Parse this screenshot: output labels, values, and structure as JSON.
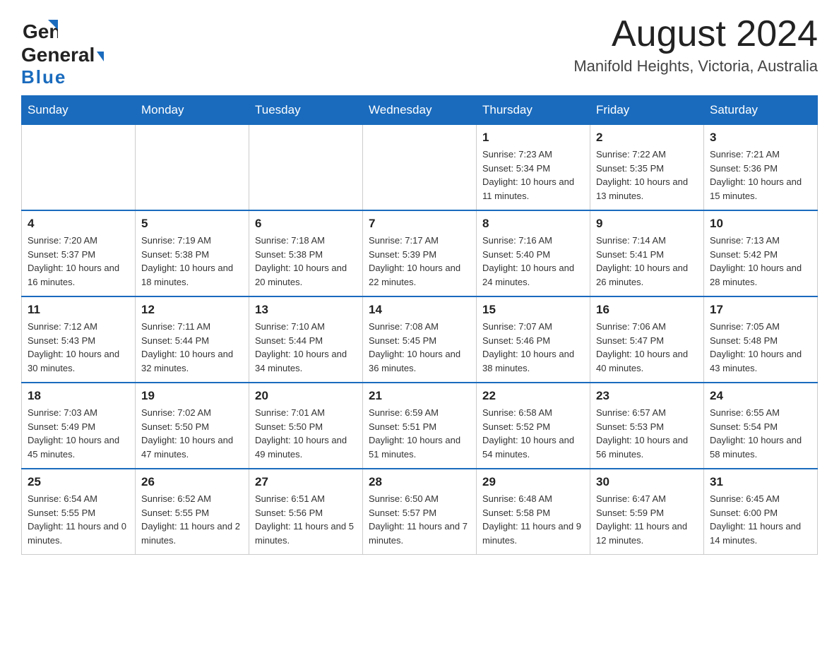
{
  "header": {
    "logo_line1": "General",
    "logo_line2": "Blue",
    "title": "August 2024",
    "subtitle": "Manifold Heights, Victoria, Australia"
  },
  "weekdays": [
    "Sunday",
    "Monday",
    "Tuesday",
    "Wednesday",
    "Thursday",
    "Friday",
    "Saturday"
  ],
  "weeks": [
    [
      {
        "day": "",
        "sunrise": "",
        "sunset": "",
        "daylight": ""
      },
      {
        "day": "",
        "sunrise": "",
        "sunset": "",
        "daylight": ""
      },
      {
        "day": "",
        "sunrise": "",
        "sunset": "",
        "daylight": ""
      },
      {
        "day": "",
        "sunrise": "",
        "sunset": "",
        "daylight": ""
      },
      {
        "day": "1",
        "sunrise": "Sunrise: 7:23 AM",
        "sunset": "Sunset: 5:34 PM",
        "daylight": "Daylight: 10 hours and 11 minutes."
      },
      {
        "day": "2",
        "sunrise": "Sunrise: 7:22 AM",
        "sunset": "Sunset: 5:35 PM",
        "daylight": "Daylight: 10 hours and 13 minutes."
      },
      {
        "day": "3",
        "sunrise": "Sunrise: 7:21 AM",
        "sunset": "Sunset: 5:36 PM",
        "daylight": "Daylight: 10 hours and 15 minutes."
      }
    ],
    [
      {
        "day": "4",
        "sunrise": "Sunrise: 7:20 AM",
        "sunset": "Sunset: 5:37 PM",
        "daylight": "Daylight: 10 hours and 16 minutes."
      },
      {
        "day": "5",
        "sunrise": "Sunrise: 7:19 AM",
        "sunset": "Sunset: 5:38 PM",
        "daylight": "Daylight: 10 hours and 18 minutes."
      },
      {
        "day": "6",
        "sunrise": "Sunrise: 7:18 AM",
        "sunset": "Sunset: 5:38 PM",
        "daylight": "Daylight: 10 hours and 20 minutes."
      },
      {
        "day": "7",
        "sunrise": "Sunrise: 7:17 AM",
        "sunset": "Sunset: 5:39 PM",
        "daylight": "Daylight: 10 hours and 22 minutes."
      },
      {
        "day": "8",
        "sunrise": "Sunrise: 7:16 AM",
        "sunset": "Sunset: 5:40 PM",
        "daylight": "Daylight: 10 hours and 24 minutes."
      },
      {
        "day": "9",
        "sunrise": "Sunrise: 7:14 AM",
        "sunset": "Sunset: 5:41 PM",
        "daylight": "Daylight: 10 hours and 26 minutes."
      },
      {
        "day": "10",
        "sunrise": "Sunrise: 7:13 AM",
        "sunset": "Sunset: 5:42 PM",
        "daylight": "Daylight: 10 hours and 28 minutes."
      }
    ],
    [
      {
        "day": "11",
        "sunrise": "Sunrise: 7:12 AM",
        "sunset": "Sunset: 5:43 PM",
        "daylight": "Daylight: 10 hours and 30 minutes."
      },
      {
        "day": "12",
        "sunrise": "Sunrise: 7:11 AM",
        "sunset": "Sunset: 5:44 PM",
        "daylight": "Daylight: 10 hours and 32 minutes."
      },
      {
        "day": "13",
        "sunrise": "Sunrise: 7:10 AM",
        "sunset": "Sunset: 5:44 PM",
        "daylight": "Daylight: 10 hours and 34 minutes."
      },
      {
        "day": "14",
        "sunrise": "Sunrise: 7:08 AM",
        "sunset": "Sunset: 5:45 PM",
        "daylight": "Daylight: 10 hours and 36 minutes."
      },
      {
        "day": "15",
        "sunrise": "Sunrise: 7:07 AM",
        "sunset": "Sunset: 5:46 PM",
        "daylight": "Daylight: 10 hours and 38 minutes."
      },
      {
        "day": "16",
        "sunrise": "Sunrise: 7:06 AM",
        "sunset": "Sunset: 5:47 PM",
        "daylight": "Daylight: 10 hours and 40 minutes."
      },
      {
        "day": "17",
        "sunrise": "Sunrise: 7:05 AM",
        "sunset": "Sunset: 5:48 PM",
        "daylight": "Daylight: 10 hours and 43 minutes."
      }
    ],
    [
      {
        "day": "18",
        "sunrise": "Sunrise: 7:03 AM",
        "sunset": "Sunset: 5:49 PM",
        "daylight": "Daylight: 10 hours and 45 minutes."
      },
      {
        "day": "19",
        "sunrise": "Sunrise: 7:02 AM",
        "sunset": "Sunset: 5:50 PM",
        "daylight": "Daylight: 10 hours and 47 minutes."
      },
      {
        "day": "20",
        "sunrise": "Sunrise: 7:01 AM",
        "sunset": "Sunset: 5:50 PM",
        "daylight": "Daylight: 10 hours and 49 minutes."
      },
      {
        "day": "21",
        "sunrise": "Sunrise: 6:59 AM",
        "sunset": "Sunset: 5:51 PM",
        "daylight": "Daylight: 10 hours and 51 minutes."
      },
      {
        "day": "22",
        "sunrise": "Sunrise: 6:58 AM",
        "sunset": "Sunset: 5:52 PM",
        "daylight": "Daylight: 10 hours and 54 minutes."
      },
      {
        "day": "23",
        "sunrise": "Sunrise: 6:57 AM",
        "sunset": "Sunset: 5:53 PM",
        "daylight": "Daylight: 10 hours and 56 minutes."
      },
      {
        "day": "24",
        "sunrise": "Sunrise: 6:55 AM",
        "sunset": "Sunset: 5:54 PM",
        "daylight": "Daylight: 10 hours and 58 minutes."
      }
    ],
    [
      {
        "day": "25",
        "sunrise": "Sunrise: 6:54 AM",
        "sunset": "Sunset: 5:55 PM",
        "daylight": "Daylight: 11 hours and 0 minutes."
      },
      {
        "day": "26",
        "sunrise": "Sunrise: 6:52 AM",
        "sunset": "Sunset: 5:55 PM",
        "daylight": "Daylight: 11 hours and 2 minutes."
      },
      {
        "day": "27",
        "sunrise": "Sunrise: 6:51 AM",
        "sunset": "Sunset: 5:56 PM",
        "daylight": "Daylight: 11 hours and 5 minutes."
      },
      {
        "day": "28",
        "sunrise": "Sunrise: 6:50 AM",
        "sunset": "Sunset: 5:57 PM",
        "daylight": "Daylight: 11 hours and 7 minutes."
      },
      {
        "day": "29",
        "sunrise": "Sunrise: 6:48 AM",
        "sunset": "Sunset: 5:58 PM",
        "daylight": "Daylight: 11 hours and 9 minutes."
      },
      {
        "day": "30",
        "sunrise": "Sunrise: 6:47 AM",
        "sunset": "Sunset: 5:59 PM",
        "daylight": "Daylight: 11 hours and 12 minutes."
      },
      {
        "day": "31",
        "sunrise": "Sunrise: 6:45 AM",
        "sunset": "Sunset: 6:00 PM",
        "daylight": "Daylight: 11 hours and 14 minutes."
      }
    ]
  ]
}
